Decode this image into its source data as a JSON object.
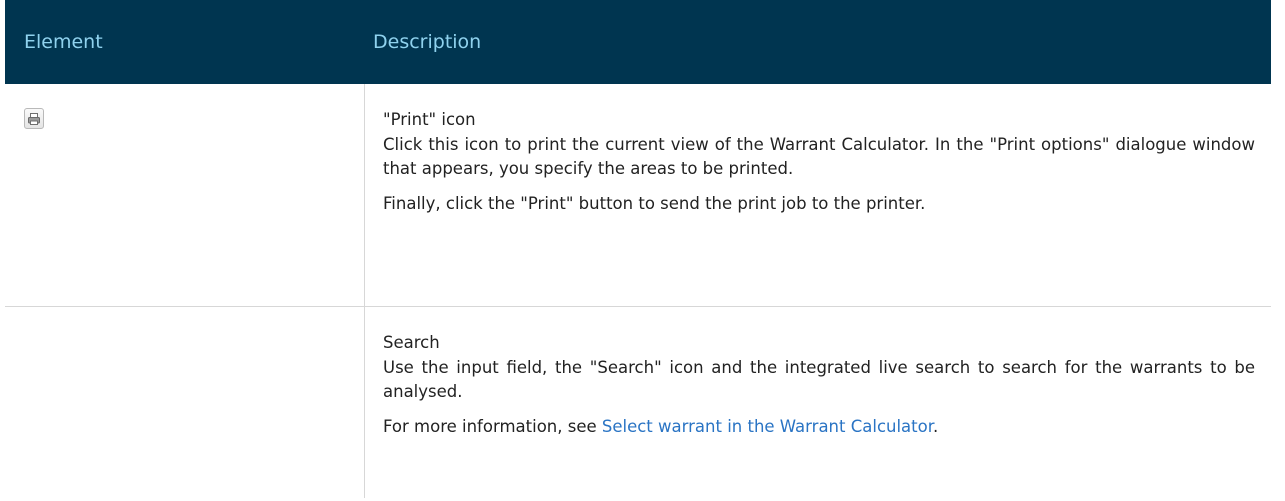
{
  "header": {
    "col_element": "Element",
    "col_description": "Description"
  },
  "rows": [
    {
      "icon": "printer-icon",
      "title": "\"Print\" icon",
      "text": "Click this icon to print the current view of the Warrant Calculator. In the \"Print options\" dialogue window that appears, you specify the areas to be printed.",
      "note": "Finally, click the \"Print\" button to send the print job to the printer."
    },
    {
      "icon": "",
      "title": "Search",
      "text": "Use the input field, the \"Search\" icon and the integrated live search to search for the warrants to be analysed.",
      "note_prefix": "For more information, see ",
      "note_link": "Select warrant in the Warrant Calculator",
      "note_suffix": "."
    }
  ],
  "colors": {
    "header_background": "#003550",
    "header_text": "#8fd2ee",
    "link": "#2a74c4"
  }
}
